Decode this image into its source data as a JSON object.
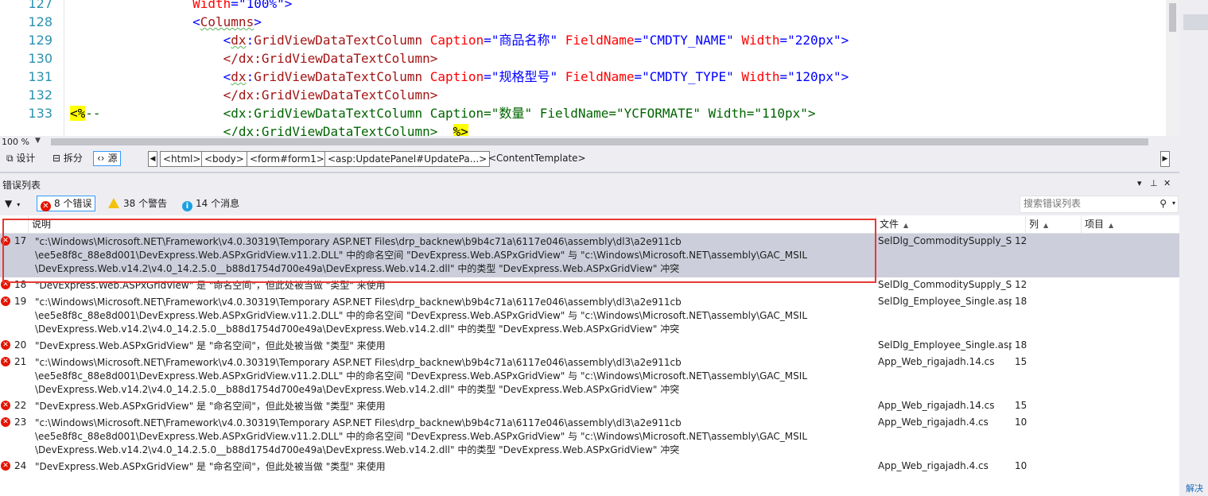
{
  "editor": {
    "lines": [
      {
        "num": "127",
        "kind": "attr_line",
        "indent": "                ",
        "attr": "Width",
        "value": "\"100%\"",
        "tail": ">"
      },
      {
        "num": "128",
        "kind": "tag_line",
        "indent": "                ",
        "open": "<",
        "tag": "Columns",
        "close": ">"
      },
      {
        "num": "129",
        "kind": "col_open",
        "indent": "                    ",
        "prefix": "dx",
        "tag": "GridViewDataTextColumn",
        "a1": "Caption",
        "v1": "\"商品名称\"",
        "a2": "FieldName",
        "v2": "\"CMDTY_NAME\"",
        "a3": "Width",
        "v3": "\"220px\""
      },
      {
        "num": "130",
        "kind": "col_close",
        "indent": "                    ",
        "text": "</dx:GridViewDataTextColumn>"
      },
      {
        "num": "131",
        "kind": "col_open",
        "indent": "                    ",
        "prefix": "dx",
        "tag": "GridViewDataTextColumn",
        "a1": "Caption",
        "v1": "\"规格型号\"",
        "a2": "FieldName",
        "v2": "\"CMDTY_TYPE\"",
        "a3": "Width",
        "v3": "\"120px\""
      },
      {
        "num": "132",
        "kind": "col_close",
        "indent": "                    ",
        "text": "</dx:GridViewDataTextColumn>"
      },
      {
        "num": "133",
        "kind": "comment_open",
        "marker": "<%",
        "dash": "--",
        "indent": "                ",
        "text": "<dx:GridViewDataTextColumn Caption=\"数量\" FieldName=\"YCFORMATE\" Width=\"110px\">"
      },
      {
        "num": "",
        "kind": "comment_close",
        "indent": "                    ",
        "text": "</dx:GridViewDataTextColumn>  ",
        "marker": "%>"
      }
    ]
  },
  "status": {
    "zoom": "100 %"
  },
  "viewbar": {
    "design": "设计",
    "split": "拆分",
    "source": "源",
    "breadcrumbs": [
      "<html>",
      "<body>",
      "<form#form1>",
      "<asp:UpdatePanel#UpdatePa...>",
      "<ContentTemplate>"
    ]
  },
  "errorlist": {
    "title": "错误列表",
    "filters": {
      "errors": "8 个错误",
      "warnings": "38 个警告",
      "messages": "14 个消息"
    },
    "search_placeholder": "搜索错误列表",
    "columns": {
      "desc": "说明",
      "file": "文件",
      "line": "列",
      "project": "项目"
    },
    "rows": [
      {
        "num": "17",
        "desc": "\"c:\\Windows\\Microsoft.NET\\Framework\\v4.0.30319\\Temporary ASP.NET Files\\drp_backnew\\b9b4c71a\\6117e046\\assembly\\dl3\\a2e911cb\n\\ee5e8f8c_88e8d001\\DevExpress.Web.ASPxGridView.v11.2.DLL\" 中的命名空间 \"DevExpress.Web.ASPxGridView\" 与 \"c:\\Windows\\Microsoft.NET\\assembly\\GAC_MSIL\n\\DevExpress.Web.v14.2\\v4.0_14.2.5.0__b88d1754d700e49a\\DevExpress.Web.v14.2.dll\" 中的类型 \"DevExpress.Web.ASPxGridView\" 冲突",
        "file": "SelDlg_CommoditySupply_Sin",
        "line": "12",
        "selected": true
      },
      {
        "num": "18",
        "desc": "\"DevExpress.Web.ASPxGridView\" 是 \"命名空间\"，但此处被当做 \"类型\" 来使用",
        "file": "SelDlg_CommoditySupply_Sin",
        "line": "12",
        "selected": false
      },
      {
        "num": "19",
        "desc": "\"c:\\Windows\\Microsoft.NET\\Framework\\v4.0.30319\\Temporary ASP.NET Files\\drp_backnew\\b9b4c71a\\6117e046\\assembly\\dl3\\a2e911cb\n\\ee5e8f8c_88e8d001\\DevExpress.Web.ASPxGridView.v11.2.DLL\" 中的命名空间 \"DevExpress.Web.ASPxGridView\" 与 \"c:\\Windows\\Microsoft.NET\\assembly\\GAC_MSIL\n\\DevExpress.Web.v14.2\\v4.0_14.2.5.0__b88d1754d700e49a\\DevExpress.Web.v14.2.dll\" 中的类型 \"DevExpress.Web.ASPxGridView\" 冲突",
        "file": "SelDlg_Employee_Single.aspx",
        "line": "18",
        "selected": false
      },
      {
        "num": "20",
        "desc": "\"DevExpress.Web.ASPxGridView\" 是 \"命名空间\"，但此处被当做 \"类型\" 来使用",
        "file": "SelDlg_Employee_Single.aspx",
        "line": "18",
        "selected": false
      },
      {
        "num": "21",
        "desc": "\"c:\\Windows\\Microsoft.NET\\Framework\\v4.0.30319\\Temporary ASP.NET Files\\drp_backnew\\b9b4c71a\\6117e046\\assembly\\dl3\\a2e911cb\n\\ee5e8f8c_88e8d001\\DevExpress.Web.ASPxGridView.v11.2.DLL\" 中的命名空间 \"DevExpress.Web.ASPxGridView\" 与 \"c:\\Windows\\Microsoft.NET\\assembly\\GAC_MSIL\n\\DevExpress.Web.v14.2\\v4.0_14.2.5.0__b88d1754d700e49a\\DevExpress.Web.v14.2.dll\" 中的类型 \"DevExpress.Web.ASPxGridView\" 冲突",
        "file": "App_Web_rigajadh.14.cs",
        "line": "15",
        "selected": false
      },
      {
        "num": "22",
        "desc": "\"DevExpress.Web.ASPxGridView\" 是 \"命名空间\"，但此处被当做 \"类型\" 来使用",
        "file": "App_Web_rigajadh.14.cs",
        "line": "15",
        "selected": false
      },
      {
        "num": "23",
        "desc": "\"c:\\Windows\\Microsoft.NET\\Framework\\v4.0.30319\\Temporary ASP.NET Files\\drp_backnew\\b9b4c71a\\6117e046\\assembly\\dl3\\a2e911cb\n\\ee5e8f8c_88e8d001\\DevExpress.Web.ASPxGridView.v11.2.DLL\" 中的命名空间 \"DevExpress.Web.ASPxGridView\" 与 \"c:\\Windows\\Microsoft.NET\\assembly\\GAC_MSIL\n\\DevExpress.Web.v14.2\\v4.0_14.2.5.0__b88d1754d700e49a\\DevExpress.Web.v14.2.dll\" 中的类型 \"DevExpress.Web.ASPxGridView\" 冲突",
        "file": "App_Web_rigajadh.4.cs",
        "line": "10",
        "selected": false
      },
      {
        "num": "24",
        "desc": "\"DevExpress.Web.ASPxGridView\" 是 \"命名空间\"，但此处被当做 \"类型\" 来使用",
        "file": "App_Web_rigajadh.4.cs",
        "line": "10",
        "selected": false
      }
    ]
  },
  "side": {
    "label": "解决"
  },
  "colors": {
    "error": "#e51400",
    "selection": "#cccedb",
    "highlight_box": "#e53935",
    "accent": "#3399ff"
  }
}
